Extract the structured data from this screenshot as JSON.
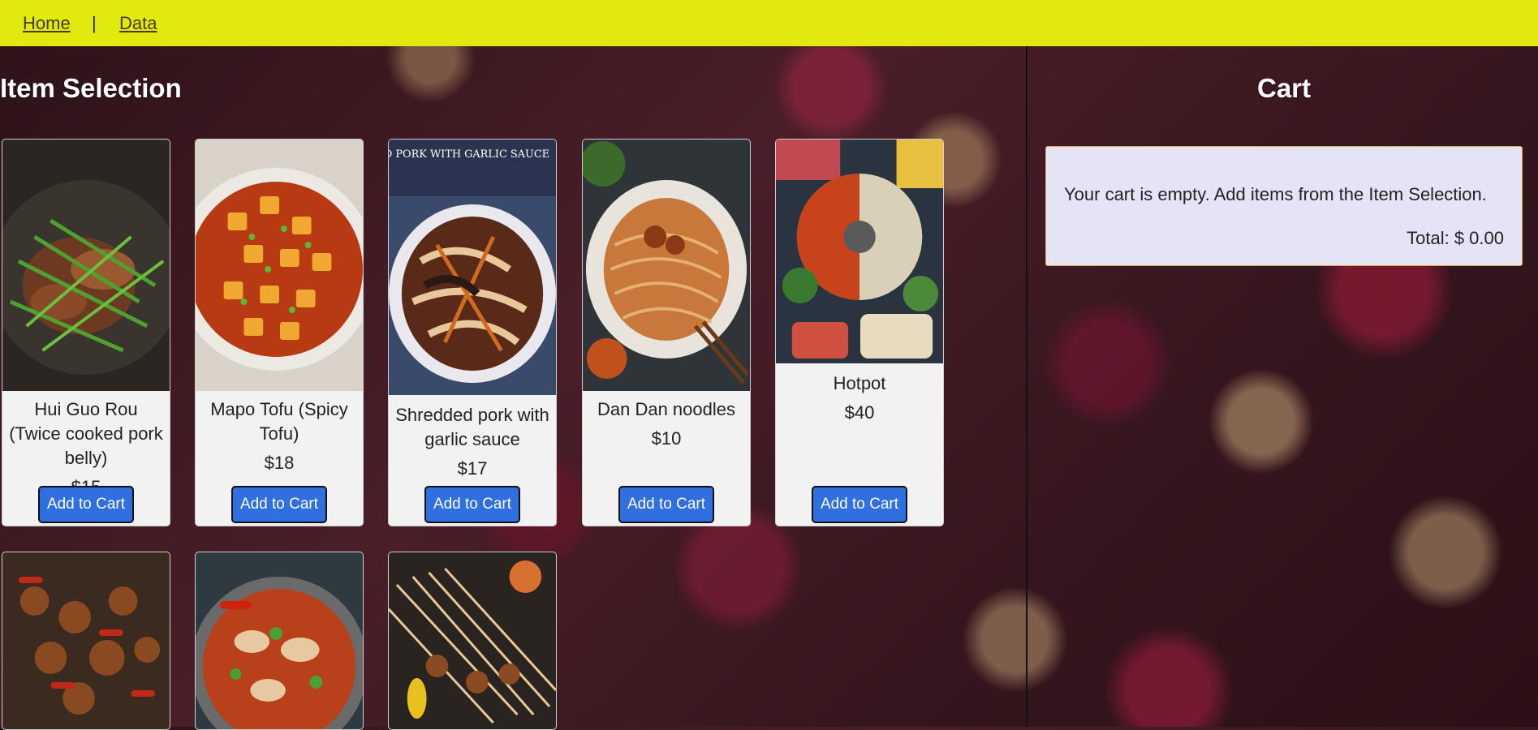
{
  "nav": {
    "home": "Home",
    "separator": "|",
    "data": "Data",
    "bar_color": "#e0ea0e"
  },
  "item_selection": {
    "title": "Item Selection",
    "items": [
      {
        "name": "Hui Guo Rou (Twice cooked pork belly)",
        "price": "$15",
        "button": "Add to Cart"
      },
      {
        "name": "Mapo Tofu (Spicy Tofu)",
        "price": "$18",
        "button": "Add to Cart"
      },
      {
        "name": "Shredded pork with garlic sauce",
        "price": "$17",
        "button": "Add to Cart",
        "photo_caption": "SHREDDED PORK WITH GARLIC SAUCE"
      },
      {
        "name": "Dan Dan noodles",
        "price": "$10",
        "button": "Add to Cart"
      },
      {
        "name": "Hotpot",
        "price": "$40",
        "button": "Add to Cart"
      }
    ]
  },
  "cart": {
    "title": "Cart",
    "empty_message": "Your cart is empty. Add items from the Item Selection.",
    "total": "Total: $ 0.00"
  },
  "colors": {
    "button": "#2f6fe0",
    "cart_bg": "#e4e4f6"
  }
}
